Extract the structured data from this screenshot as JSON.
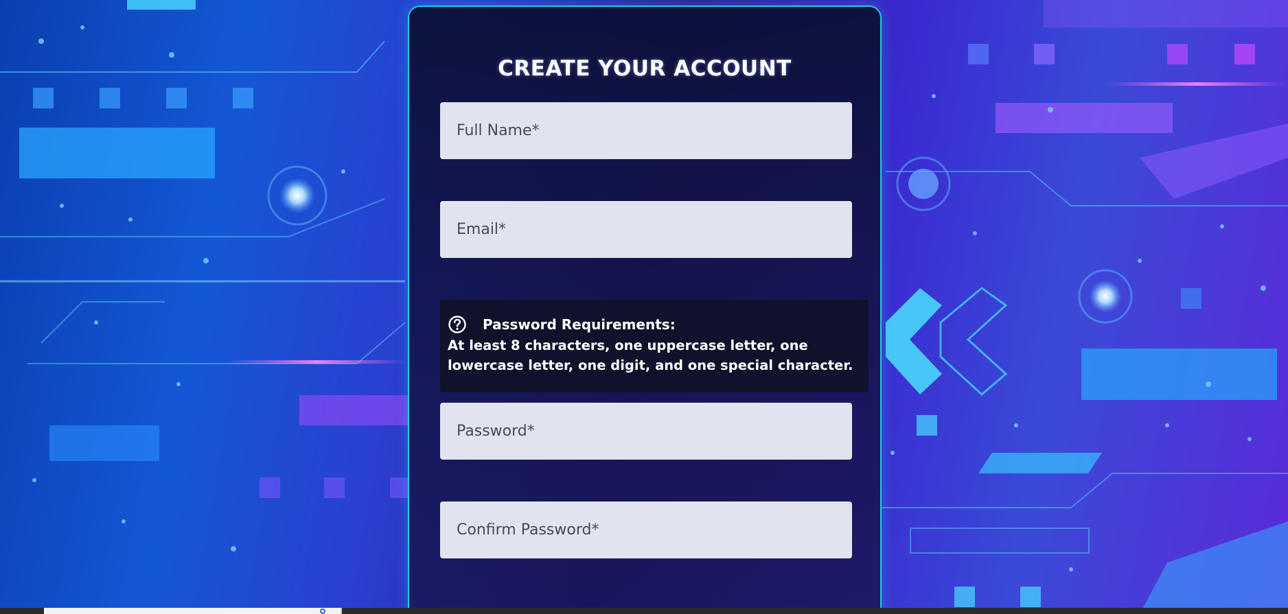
{
  "form": {
    "title": "CREATE YOUR ACCOUNT",
    "full_name_placeholder": "Full Name*",
    "email_placeholder": "Email*",
    "password_placeholder": "Password*",
    "confirm_password_placeholder": "Confirm Password*"
  },
  "password_requirements": {
    "icon": "question-circle-icon",
    "heading": "Password Requirements:",
    "text": "At least 8 characters, one uppercase letter, one lowercase letter, one digit, and one special character."
  },
  "taskbar": {
    "search_icon": "search-icon"
  },
  "colors": {
    "panel_border": "#21c8e6",
    "input_bg": "#e1e3ee"
  }
}
